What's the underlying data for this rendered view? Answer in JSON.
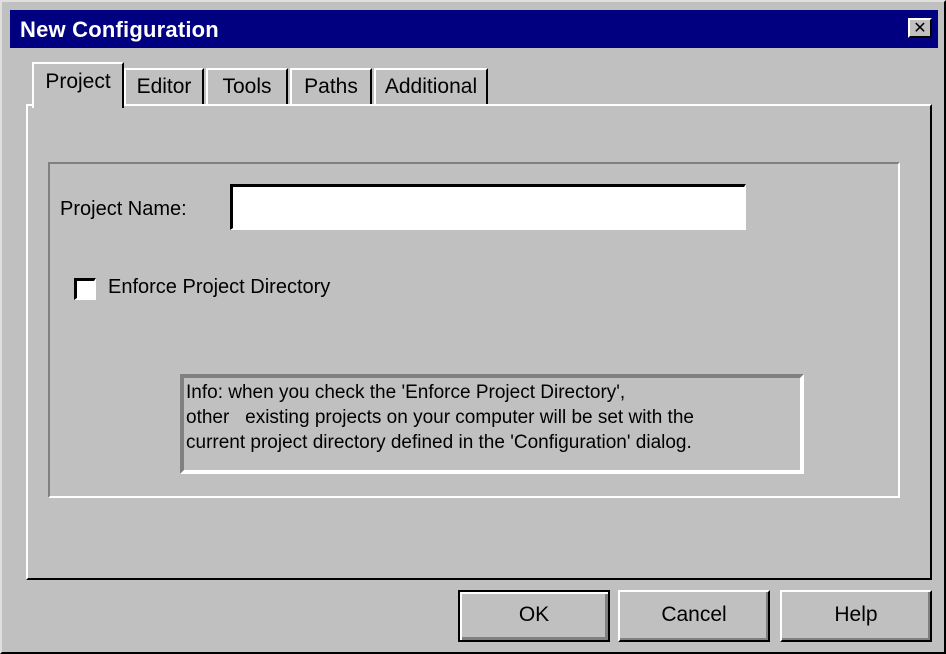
{
  "window": {
    "title": "New Configuration",
    "close_symbol": "✕",
    "close_icon": "close-icon"
  },
  "tabs": [
    {
      "label": "Project",
      "active": true
    },
    {
      "label": "Editor",
      "active": false
    },
    {
      "label": "Tools",
      "active": false
    },
    {
      "label": "Paths",
      "active": false
    },
    {
      "label": "Additional",
      "active": false
    }
  ],
  "project": {
    "name_label": "Project Name:",
    "name_value": "",
    "enforce_label": "Enforce Project Directory",
    "enforce_checked": false,
    "info_lines": [
      "Info: when you check the 'Enforce Project Directory',",
      "other   existing projects on your computer will be set with the",
      "current project directory defined in the 'Configuration' dialog."
    ]
  },
  "buttons": {
    "ok": "OK",
    "cancel": "Cancel",
    "help": "Help"
  },
  "colors": {
    "titlebar": "#000080",
    "face": "#c0c0c0",
    "input_bg": "#ffffff"
  }
}
